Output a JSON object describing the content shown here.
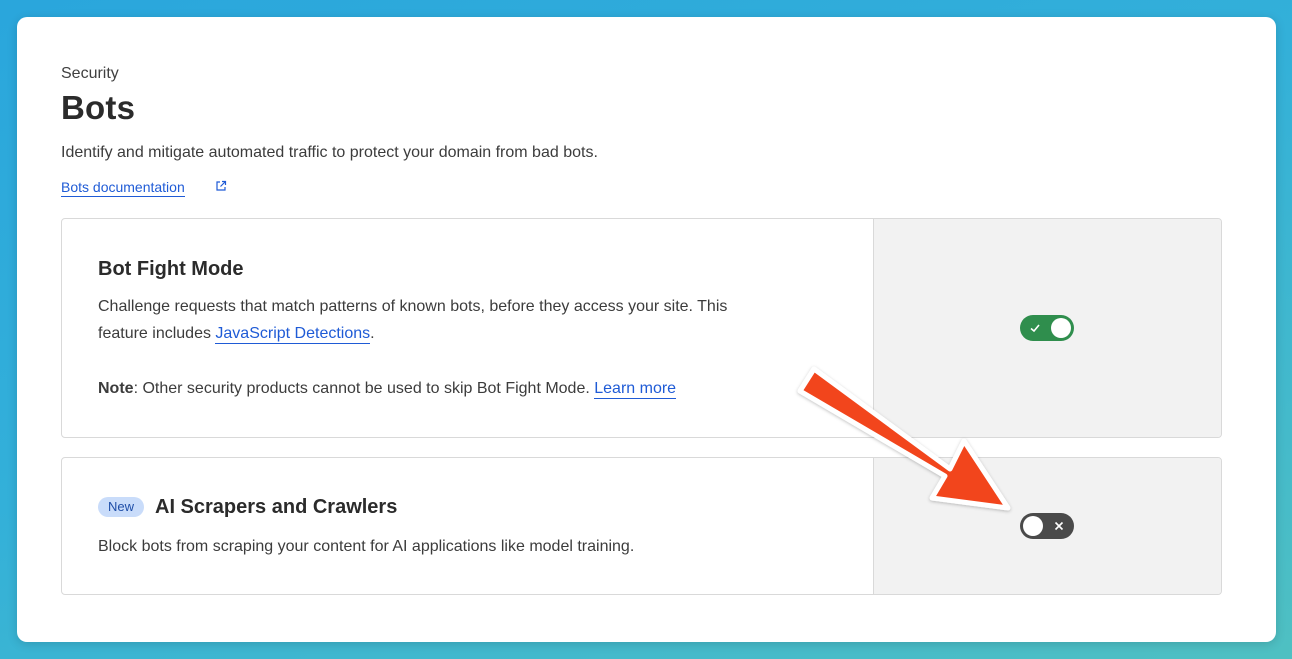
{
  "header": {
    "breadcrumb": "Security",
    "title": "Bots",
    "description": "Identify and mitigate automated traffic to protect your domain from bad bots.",
    "doc_link": "Bots documentation"
  },
  "cards": [
    {
      "title": "Bot Fight Mode",
      "description_line1": "Challenge requests that match patterns of known bots, before they access your site. This",
      "description_prefix": "feature includes ",
      "description_link": "JavaScript Detections",
      "description_suffix": ".",
      "note_label": "Note",
      "note_text": ": Other security products cannot be used to skip Bot Fight Mode. ",
      "note_link": "Learn more",
      "toggle_state": "on"
    },
    {
      "badge": "New",
      "title": "AI Scrapers and Crawlers",
      "description": "Block bots from scraping your content for AI applications like model training.",
      "toggle_state": "off"
    }
  ],
  "colors": {
    "accent_link": "#1f5bd6",
    "toggle_on": "#2f8e4d",
    "toggle_off": "#4a4a4a",
    "annotation_arrow": "#f2441d"
  },
  "icons": {
    "doc_link": "external-link-icon",
    "toggle_on": "check-icon",
    "toggle_off": "x-icon"
  }
}
